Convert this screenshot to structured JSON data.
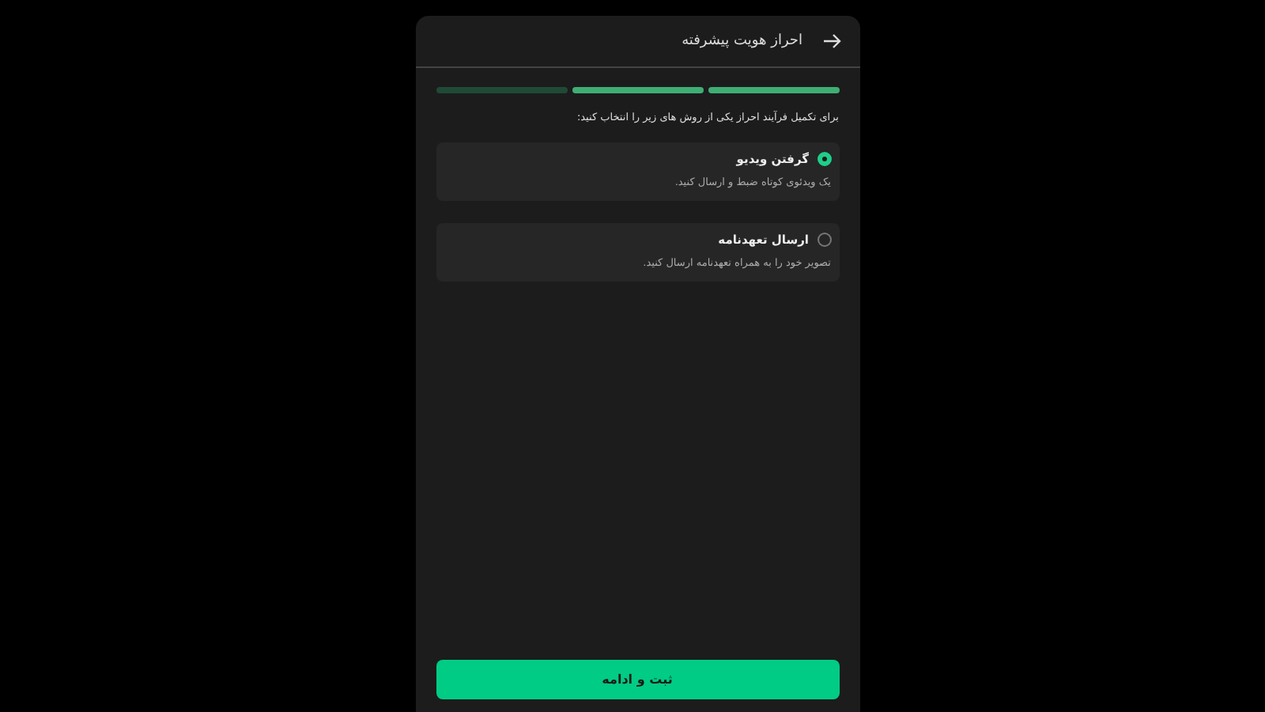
{
  "header": {
    "title": "احراز هویت پیشرفته"
  },
  "steps": [
    {
      "done": true
    },
    {
      "done": true
    },
    {
      "done": false
    }
  ],
  "instruction": "برای تکمیل فرآیند احراز یکی از روش های زیر را انتخاب کنید:",
  "options": [
    {
      "title": "گرفتن ویدیو",
      "description": "یک ویدئوی کوتاه ضبط و ارسال کنید.",
      "selected": true
    },
    {
      "title": "ارسال تعهدنامه",
      "description": "تصویر خود را به همراه تعهدنامه ارسال کنید.",
      "selected": false
    }
  ],
  "submit_button": "ثبت و ادامه"
}
